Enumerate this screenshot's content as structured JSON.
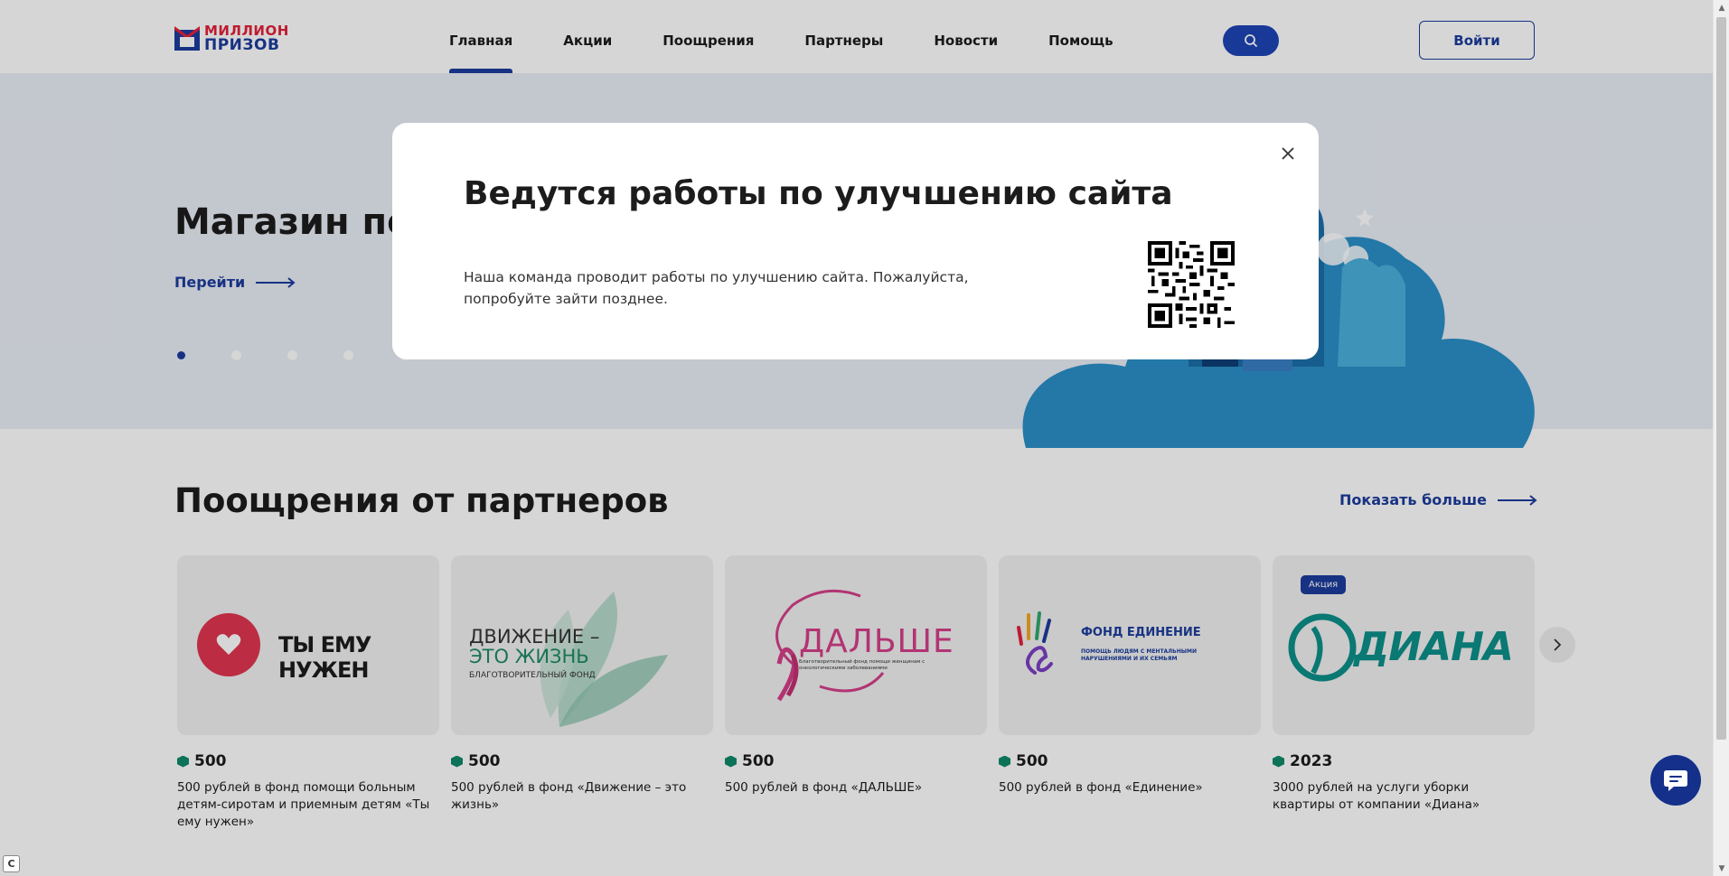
{
  "header": {
    "logo_line1": "МИЛЛИОН",
    "logo_line2": "ПРИЗОВ",
    "nav": [
      {
        "label": "Главная"
      },
      {
        "label": "Акции"
      },
      {
        "label": "Поощрения"
      },
      {
        "label": "Партнеры"
      },
      {
        "label": "Новости"
      },
      {
        "label": "Помощь"
      }
    ],
    "active_nav": "Главная",
    "login_label": "Войти"
  },
  "hero": {
    "title": "Магазин по",
    "link_label": "Перейти",
    "slides_count": 5,
    "active_slide": 1
  },
  "partners": {
    "title": "Поощрения от партнеров",
    "more_label": "Показать больше",
    "cards": [
      {
        "brand": "ТЫ ЕМУ НУЖЕН",
        "value": "500",
        "desc": "500 рублей в фонд помощи больным детям-сиротам и приемным детям «Ты ему нужен»"
      },
      {
        "brand_line1": "ДВИЖЕНИЕ –",
        "brand_line2": "ЭТО ЖИЗНЬ",
        "brand_sub": "БЛАГОТВОРИТЕЛЬНЫЙ ФОНД",
        "value": "500",
        "desc": "500 рублей в фонд «Движение – это жизнь»"
      },
      {
        "brand": "ДАЛЬШЕ",
        "brand_sub": "Благотворительный фонд помощи женщинам с онкологическими заболеваниями",
        "value": "500",
        "desc": "500 рублей в фонд «ДАЛЬШЕ»"
      },
      {
        "brand": "ФОНД ЕДИНЕНИЕ",
        "brand_sub": "ПОМОЩЬ ЛЮДЯМ С МЕНТАЛЬНЫМИ НАРУШЕНИЯМИ И ИХ СЕМЬЯМ",
        "value": "500",
        "desc": "500 рублей в фонд «Единение»"
      },
      {
        "brand": "ДИАНА",
        "badge": "Акция",
        "value": "2023",
        "desc": "3000 рублей на услуги уборки квартиры от компании «Диана»"
      }
    ]
  },
  "modal": {
    "title": "Ведутся работы по улучшению сайта",
    "text": "Наша команда проводит работы по улучшению сайта. Пожалуйста, попробуйте зайти позднее."
  },
  "colors": {
    "brand_blue": "#1c3c9c",
    "brand_red": "#e3213a",
    "gem_green": "#0f8a6a"
  },
  "icons": {
    "search": "search-icon",
    "close": "close-icon",
    "chat": "chat-icon",
    "next": "chevron-right-icon"
  }
}
